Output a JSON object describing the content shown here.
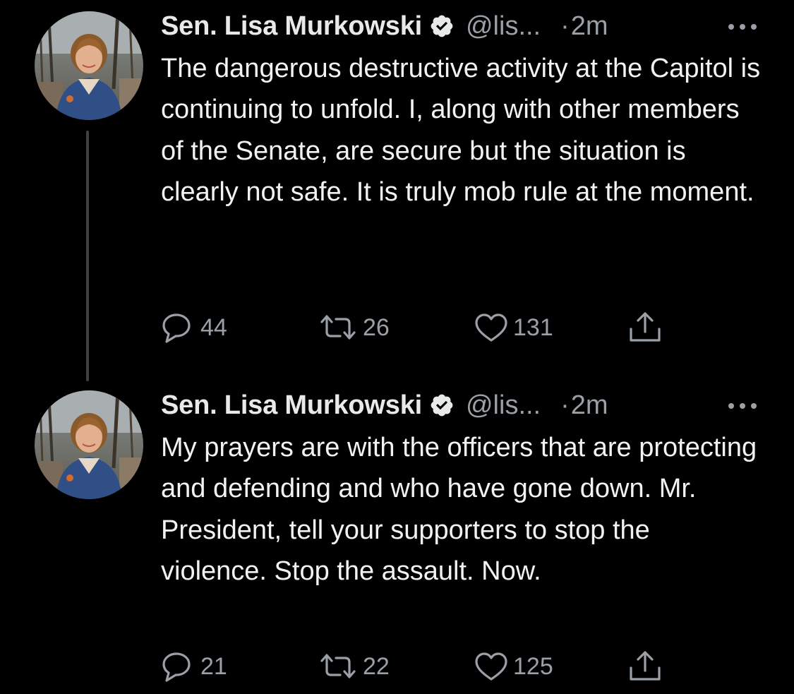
{
  "colors": {
    "background": "#000000",
    "text": "#e7e9ea",
    "secondary_text": "#9aa0a6",
    "thread_line": "#3e4144"
  },
  "tweets": [
    {
      "author": {
        "display_name": "Sen. Lisa Murkowski",
        "verified_icon": "verified-badge-icon",
        "handle": "@lis...",
        "avatar_icon": "avatar"
      },
      "separator": "·",
      "time": "2m",
      "more_icon": "more-options-icon",
      "text": "The dangerous destructive activity at the Capitol is continuing to unfold. I, along with other members of the Senate, are secure but the situation is clearly not safe. It is truly mob rule at the moment.",
      "actions": {
        "replies": "44",
        "retweets": "26",
        "likes": "131"
      }
    },
    {
      "author": {
        "display_name": "Sen. Lisa Murkowski",
        "verified_icon": "verified-badge-icon",
        "handle": "@lis...",
        "avatar_icon": "avatar"
      },
      "separator": "·",
      "time": "2m",
      "more_icon": "more-options-icon",
      "text": "My prayers are with the officers that are protecting and defending and who have gone down. Mr. President, tell your supporters to stop the violence. Stop the assault. Now.",
      "actions": {
        "replies": "21",
        "retweets": "22",
        "likes": "125"
      }
    }
  ],
  "icons": {
    "reply": "reply-icon",
    "retweet": "retweet-icon",
    "like": "heart-icon",
    "share": "share-icon"
  }
}
